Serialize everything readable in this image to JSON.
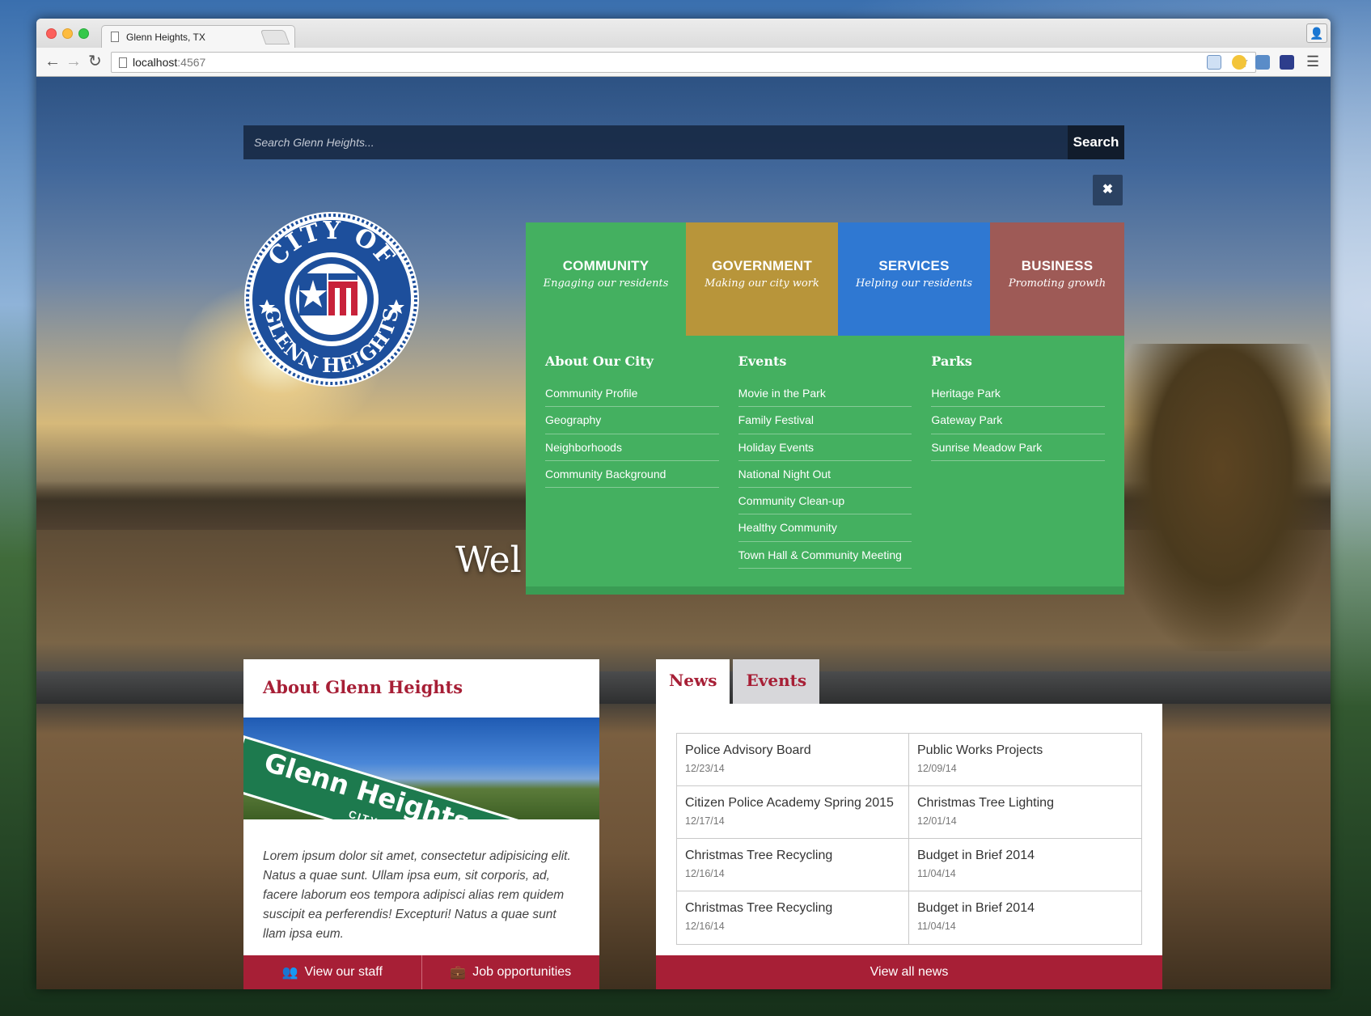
{
  "browser": {
    "tab_title": "Glenn Heights, TX",
    "url_host": "localhost",
    "url_port": ":4567"
  },
  "search": {
    "placeholder": "Search Glenn Heights...",
    "button_label": "Search"
  },
  "close_label": "✖",
  "seal": {
    "top_text": "CITY OF",
    "bottom_text": "GLENN HEIGHTS"
  },
  "mega_menu": {
    "tabs": [
      {
        "title": "COMMUNITY",
        "subtitle": "Engaging our residents",
        "color": "#44b060"
      },
      {
        "title": "GOVERNMENT",
        "subtitle": "Making our city work",
        "color": "#b8953a"
      },
      {
        "title": "SERVICES",
        "subtitle": "Helping our residents",
        "color": "#2f78d2"
      },
      {
        "title": "BUSINESS",
        "subtitle": "Promoting growth",
        "color": "#9e5a56"
      }
    ],
    "columns": [
      {
        "heading": "About Our City",
        "links": [
          "Community Profile",
          "Geography",
          "Neighborhoods",
          "Community Background"
        ]
      },
      {
        "heading": "Events",
        "links": [
          "Movie in the Park",
          "Family Festival",
          "Holiday Events",
          "National Night Out",
          "Community Clean-up",
          "Healthy Community",
          "Town Hall & Community Meeting"
        ]
      },
      {
        "heading": "Parks",
        "links": [
          "Heritage Park",
          "Gateway Park",
          "Sunrise Meadow Park"
        ]
      }
    ]
  },
  "hero": {
    "welcome_fragment": "Wel"
  },
  "about": {
    "title": "About Glenn Heights",
    "sign_text": "Glenn Heights",
    "sign_subtext": "CITY LIMIT",
    "body": "Lorem ipsum dolor sit amet, consectetur adipisicing elit. Natus a quae sunt. Ullam ipsa eum, sit corporis, ad, facere laborum eos tempora adipisci alias rem quidem suscipit ea perferendis! Excepturi! Natus a quae sunt llam ipsa eum.",
    "staff_button": "View our staff",
    "jobs_button": "Job opportunities"
  },
  "news": {
    "tabs": [
      "News",
      "Events"
    ],
    "items": [
      {
        "title": "Police Advisory Board",
        "date": "12/23/14"
      },
      {
        "title": "Public Works Projects",
        "date": "12/09/14"
      },
      {
        "title": "Citizen Police Academy Spring 2015",
        "date": "12/17/14"
      },
      {
        "title": "Christmas Tree Lighting",
        "date": "12/01/14"
      },
      {
        "title": "Christmas Tree Recycling",
        "date": "12/16/14"
      },
      {
        "title": "Budget in Brief 2014",
        "date": "11/04/14"
      },
      {
        "title": "Christmas Tree Recycling",
        "date": "12/16/14"
      },
      {
        "title": "Budget in Brief 2014",
        "date": "11/04/14"
      }
    ],
    "view_all": "View all news"
  },
  "colors": {
    "brand_red": "#a71f36",
    "community_green": "#44b060"
  }
}
